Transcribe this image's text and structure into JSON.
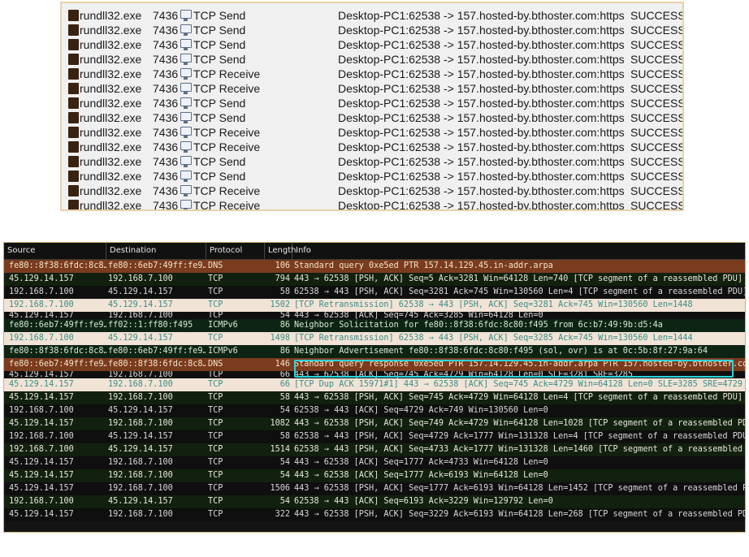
{
  "procmon": {
    "rows": [
      {
        "process": "rundll32.exe",
        "pid": "7436",
        "operation": "TCP Send",
        "path": "Desktop-PC1:62538 -> 157.hosted-by.bthoster.com:https",
        "result": "SUCCESS"
      },
      {
        "process": "rundll32.exe",
        "pid": "7436",
        "operation": "TCP Send",
        "path": "Desktop-PC1:62538 -> 157.hosted-by.bthoster.com:https",
        "result": "SUCCESS"
      },
      {
        "process": "rundll32.exe",
        "pid": "7436",
        "operation": "TCP Send",
        "path": "Desktop-PC1:62538 -> 157.hosted-by.bthoster.com:https",
        "result": "SUCCESS"
      },
      {
        "process": "rundll32.exe",
        "pid": "7436",
        "operation": "TCP Send",
        "path": "Desktop-PC1:62538 -> 157.hosted-by.bthoster.com:https",
        "result": "SUCCESS"
      },
      {
        "process": "rundll32.exe",
        "pid": "7436",
        "operation": "TCP Receive",
        "path": "Desktop-PC1:62538 -> 157.hosted-by.bthoster.com:https",
        "result": "SUCCESS"
      },
      {
        "process": "rundll32.exe",
        "pid": "7436",
        "operation": "TCP Receive",
        "path": "Desktop-PC1:62538 -> 157.hosted-by.bthoster.com:https",
        "result": "SUCCESS"
      },
      {
        "process": "rundll32.exe",
        "pid": "7436",
        "operation": "TCP Send",
        "path": "Desktop-PC1:62538 -> 157.hosted-by.bthoster.com:https",
        "result": "SUCCESS"
      },
      {
        "process": "rundll32.exe",
        "pid": "7436",
        "operation": "TCP Send",
        "path": "Desktop-PC1:62538 -> 157.hosted-by.bthoster.com:https",
        "result": "SUCCESS"
      },
      {
        "process": "rundll32.exe",
        "pid": "7436",
        "operation": "TCP Receive",
        "path": "Desktop-PC1:62538 -> 157.hosted-by.bthoster.com:https",
        "result": "SUCCESS"
      },
      {
        "process": "rundll32.exe",
        "pid": "7436",
        "operation": "TCP Receive",
        "path": "Desktop-PC1:62538 -> 157.hosted-by.bthoster.com:https",
        "result": "SUCCESS"
      },
      {
        "process": "rundll32.exe",
        "pid": "7436",
        "operation": "TCP Send",
        "path": "Desktop-PC1:62538 -> 157.hosted-by.bthoster.com:https",
        "result": "SUCCESS"
      },
      {
        "process": "rundll32.exe",
        "pid": "7436",
        "operation": "TCP Send",
        "path": "Desktop-PC1:62538 -> 157.hosted-by.bthoster.com:https",
        "result": "SUCCESS"
      },
      {
        "process": "rundll32.exe",
        "pid": "7436",
        "operation": "TCP Receive",
        "path": "Desktop-PC1:62538 -> 157.hosted-by.bthoster.com:https",
        "result": "SUCCESS"
      },
      {
        "process": "rundll32.exe",
        "pid": "7436",
        "operation": "TCP Receive",
        "path": "Desktop-PC1:62538 -> 157.hosted-by.bthoster.com:https",
        "result": "SUCCESS"
      }
    ],
    "process_icon": "process-icon",
    "operation_icon": "network-monitor-icon"
  },
  "wireshark": {
    "headers": {
      "source": "Source",
      "destination": "Destination",
      "protocol": "Protocol",
      "length": "Length",
      "info": "Info"
    },
    "rows": [
      {
        "style": "dns",
        "source": "fe80::8f38:6fdc:8c8…",
        "destination": "fe80::6eb7:49ff:fe9…",
        "protocol": "DNS",
        "length": "106",
        "info": "Standard query 0xe5ed PTR 157.14.129.45.in-addr.arpa"
      },
      {
        "style": "dark",
        "source": "45.129.14.157",
        "destination": "192.168.7.100",
        "protocol": "TCP",
        "length": "794",
        "info": "443 → 62538 [PSH, ACK] Seq=5 Ack=3281 Win=64128 Len=740 [TCP segment of a reassembled PDU]"
      },
      {
        "style": "black",
        "source": "192.168.7.100",
        "destination": "45.129.14.157",
        "protocol": "TCP",
        "length": "58",
        "info": "62538 → 443 [PSH, ACK] Seq=3281 Ack=745 Win=130560 Len=4 [TCP segment of a reassembled PDU]"
      },
      {
        "style": "retx",
        "source": "192.168.7.100",
        "destination": "45.129.14.157",
        "protocol": "TCP",
        "length": "1502",
        "info": "[TCP Retransmission] 62538 → 443 [PSH, ACK] Seq=3281 Ack=745 Win=130560 Len=1448"
      },
      {
        "style": "cut",
        "source": "45.129.14.157",
        "destination": "192.168.7.100",
        "protocol": "TCP",
        "length": "54",
        "info": "443 → 62538 [ACK] Seq=745 Ack=3285 Win=64128 Len=0"
      },
      {
        "style": "icmp",
        "source": "fe80::6eb7:49ff:fe9…",
        "destination": "ff02::1:ff80:f495",
        "protocol": "ICMPv6",
        "length": "86",
        "info": "Neighbor Solicitation for fe80::8f38:6fdc:8c80:f495 from 6c:b7:49:9b:d5:4a"
      },
      {
        "style": "retx",
        "source": "192.168.7.100",
        "destination": "45.129.14.157",
        "protocol": "TCP",
        "length": "1498",
        "info": "[TCP Retransmission] 62538 → 443 [PSH, ACK] Seq=3285 Ack=745 Win=130560 Len=1444"
      },
      {
        "style": "icmp",
        "source": "fe80::8f38:6fdc:8c8…",
        "destination": "fe80::6eb7:49ff:fe9…",
        "protocol": "ICMPv6",
        "length": "86",
        "info": "Neighbor Advertisement fe80::8f38:6fdc:8c80:f495 (sol, ovr) is at 0c:5b:8f:27:9a:64"
      },
      {
        "style": "dns",
        "source": "fe80::6eb7:49ff:fe9…",
        "destination": "fe80::8f38:6fdc:8c8…",
        "protocol": "DNS",
        "length": "146",
        "info": "Standard query response 0xe5ed PTR 157.14.129.45.in-addr.arpa PTR 157.hosted-by.bthoster.com"
      },
      {
        "style": "cut",
        "source": "45.129.14.157",
        "destination": "192.168.7.100",
        "protocol": "TCP",
        "length": "66",
        "info": "443 → 62538 [ACK] Seq=745 Ack=4729 Win=64128 Len=0 SLE=3281 SRE=3285"
      },
      {
        "style": "retx",
        "source": "45.129.14.157",
        "destination": "192.168.7.100",
        "protocol": "TCP",
        "length": "66",
        "info": "[TCP Dup ACK 15971#1] 443 → 62538 [ACK] Seq=745 Ack=4729 Win=64128 Len=0 SLE=3285 SRE=4729"
      },
      {
        "style": "dark",
        "source": "45.129.14.157",
        "destination": "192.168.7.100",
        "protocol": "TCP",
        "length": "58",
        "info": "443 → 62538 [PSH, ACK] Seq=745 Ack=4729 Win=64128 Len=4 [TCP segment of a reassembled PDU]"
      },
      {
        "style": "black",
        "source": "192.168.7.100",
        "destination": "45.129.14.157",
        "protocol": "TCP",
        "length": "54",
        "info": "62538 → 443 [ACK] Seq=4729 Ack=749 Win=130560 Len=0"
      },
      {
        "style": "dark",
        "source": "45.129.14.157",
        "destination": "192.168.7.100",
        "protocol": "TCP",
        "length": "1082",
        "info": "443 → 62538 [PSH, ACK] Seq=749 Ack=4729 Win=64128 Len=1028 [TCP segment of a reassembled PDU]"
      },
      {
        "style": "black",
        "source": "192.168.7.100",
        "destination": "45.129.14.157",
        "protocol": "TCP",
        "length": "58",
        "info": "62538 → 443 [PSH, ACK] Seq=4729 Ack=1777 Win=131328 Len=4 [TCP segment of a reassembled PDU]"
      },
      {
        "style": "dark",
        "source": "192.168.7.100",
        "destination": "45.129.14.157",
        "protocol": "TCP",
        "length": "1514",
        "info": "62538 → 443 [PSH, ACK] Seq=4733 Ack=1777 Win=131328 Len=1460 [TCP segment of a reassembled PDU]"
      },
      {
        "style": "black",
        "source": "45.129.14.157",
        "destination": "192.168.7.100",
        "protocol": "TCP",
        "length": "54",
        "info": "443 → 62538 [ACK] Seq=1777 Ack=4733 Win=64128 Len=0"
      },
      {
        "style": "dark",
        "source": "45.129.14.157",
        "destination": "192.168.7.100",
        "protocol": "TCP",
        "length": "54",
        "info": "443 → 62538 [ACK] Seq=1777 Ack=6193 Win=64128 Len=0"
      },
      {
        "style": "black",
        "source": "45.129.14.157",
        "destination": "192.168.7.100",
        "protocol": "TCP",
        "length": "1506",
        "info": "443 → 62538 [PSH, ACK] Seq=1777 Ack=6193 Win=64128 Len=1452 [TCP segment of a reassembled PDU]"
      },
      {
        "style": "dark",
        "source": "192.168.7.100",
        "destination": "45.129.14.157",
        "protocol": "TCP",
        "length": "54",
        "info": "62538 → 443 [ACK] Seq=6193 Ack=3229 Win=129792 Len=0"
      },
      {
        "style": "black",
        "source": "45.129.14.157",
        "destination": "192.168.7.100",
        "protocol": "TCP",
        "length": "322",
        "info": "443 → 62538 [PSH, ACK] Seq=3229 Ack=6193 Win=64128 Len=268 [TCP segment of a reassembled PDU]"
      }
    ],
    "highlight_color": "#2ad5dc"
  }
}
